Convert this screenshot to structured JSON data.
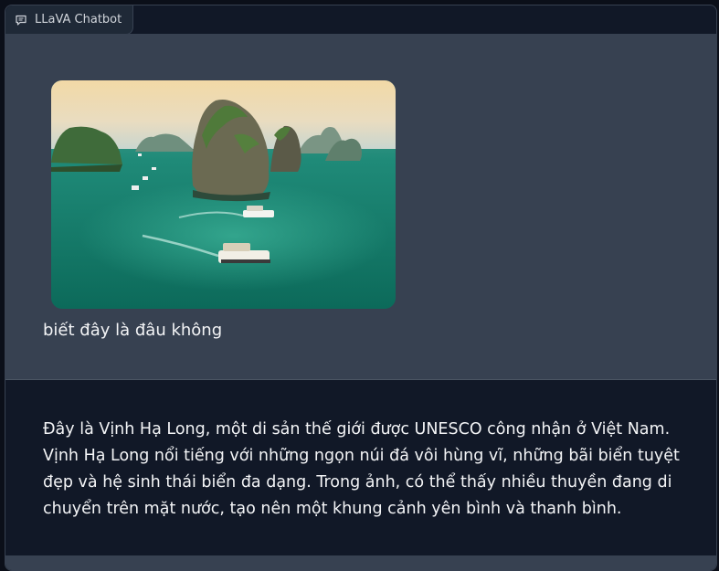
{
  "chatbot": {
    "label": "LLaVA Chatbot",
    "label_icon": "chat-bubble-icon"
  },
  "messages": [
    {
      "role": "user",
      "image": "ha-long-bay-photo",
      "text": "biết đây là đâu không"
    },
    {
      "role": "assistant",
      "text": "Đây là Vịnh Hạ Long, một di sản thế giới được UNESCO công nhận ở Việt Nam. Vịnh Hạ Long nổi tiếng với những ngọn núi đá vôi hùng vĩ, những bãi biển tuyệt đẹp và hệ sinh thái biển đa dạng. Trong ảnh, có thể thấy nhiều thuyền đang di chuyển trên mặt nước, tạo nên một khung cảnh yên bình và thanh bình."
    }
  ],
  "colors": {
    "background": "#0b0f19",
    "panel": "#111827",
    "user_bubble": "#374151",
    "text": "#f3f4f6"
  }
}
